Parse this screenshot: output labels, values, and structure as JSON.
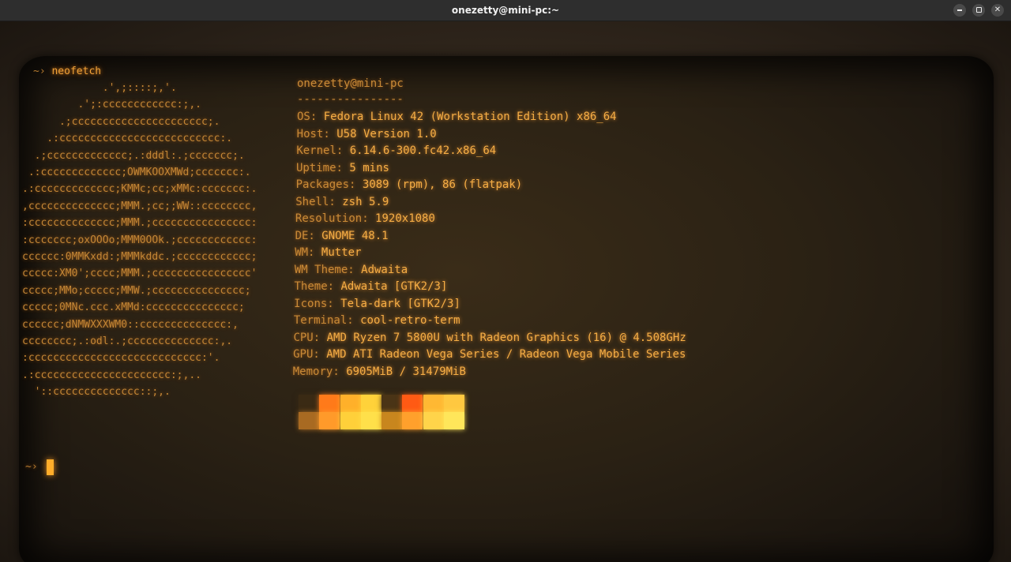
{
  "window": {
    "title": "onezetty@mini-pc:~",
    "buttons": {
      "minimize": "minimize",
      "maximize": "maximize",
      "close": "✕"
    }
  },
  "terminal": {
    "prompt_symbol": "~›",
    "command": "neofetch",
    "logo_lines": [
      "             .',;::::;,'.",
      "         .';:cccccccccccc:;,.",
      "      .;cccccccccccccccccccccc;.",
      "    .:cccccccccccccccccccccccccc:.",
      "  .;ccccccccccccc;.:dddl:.;ccccccc;.",
      " .:ccccccccccccc;OWMKOOXMWd;ccccccc:.",
      ".:ccccccccccccc;KMMc;cc;xMMc:ccccccc:.",
      ",cccccccccccccc;MMM.;cc;;WW::cccccccc,",
      ":cccccccccccccc;MMM.;cccccccccccccccc:",
      ":ccccccc;oxOOOo;MMM0OOk.;cccccccccccc:",
      "cccccc:0MMKxdd:;MMMkddc.;cccccccccccc;",
      "ccccc:XM0';cccc;MMM.;cccccccccccccccc'",
      "ccccc;MMo;ccccc;MMW.;ccccccccccccccc;",
      "ccccc;0MNc.ccc.xMMd:ccccccccccccccc;",
      "cccccc;dNMWXXXWM0::cccccccccccccc:,",
      "cccccccc;.:odl:.;cccccccccccccc:,.",
      ":cccccccccccccccccccccccccccc:'.",
      ".:cccccccccccccccccccccc:;,..",
      "  '::cccccccccccccc::;,."
    ],
    "header": "onezetty@mini-pc",
    "separator": "----------------",
    "info": [
      {
        "key": "OS:",
        "value": " Fedora Linux 42 (Workstation Edition) x86_64"
      },
      {
        "key": "Host:",
        "value": " U58 Version 1.0"
      },
      {
        "key": "Kernel:",
        "value": " 6.14.6-300.fc42.x86_64"
      },
      {
        "key": "Uptime:",
        "value": " 5 mins"
      },
      {
        "key": "Packages:",
        "value": " 3089 (rpm), 86 (flatpak)"
      },
      {
        "key": "Shell:",
        "value": " zsh 5.9"
      },
      {
        "key": "Resolution:",
        "value": " 1920x1080"
      },
      {
        "key": "DE:",
        "value": " GNOME 48.1"
      },
      {
        "key": "WM:",
        "value": " Mutter"
      },
      {
        "key": "WM Theme:",
        "value": " Adwaita"
      },
      {
        "key": "Theme:",
        "value": " Adwaita [GTK2/3]"
      },
      {
        "key": "Icons:",
        "value": " Tela-dark [GTK2/3]"
      },
      {
        "key": "Terminal:",
        "value": " cool-retro-term"
      },
      {
        "key": "CPU:",
        "value": " AMD Ryzen 7 5800U with Radeon Graphics (16) @ 4.508GHz"
      },
      {
        "key": "GPU:",
        "value": " AMD ATI Radeon Vega Series / Radeon Vega Mobile Series"
      },
      {
        "key": "Memory:",
        "value": " 6905MiB / 31479MiB"
      }
    ],
    "palette_colors": [
      [
        "#3a2a14",
        "#ff7a1a",
        "#ffb02a",
        "#ffd23a",
        "#4a3416",
        "#ff5a14",
        "#ffb833",
        "#ffc840"
      ],
      [
        "#a86a22",
        "#ff9a2a",
        "#ffd03a",
        "#ffe04a",
        "#c8861e",
        "#ffa02c",
        "#ffd44a",
        "#ffe65a"
      ]
    ],
    "final_prompt": "~›"
  },
  "colors": {
    "phosphor": "#f1a238",
    "bezel": "#2b2219"
  }
}
